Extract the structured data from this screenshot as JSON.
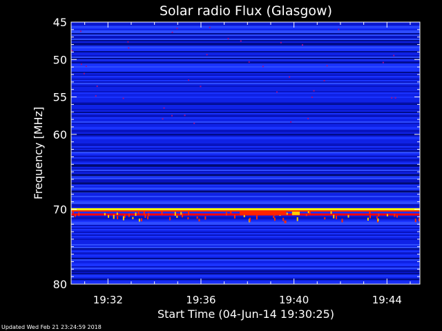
{
  "chart_data": {
    "type": "heatmap",
    "title": "Solar radio Flux (Glasgow)",
    "xlabel": "Start Time (04-Jun-14 19:30:25)",
    "ylabel": "Frequency [MHz]",
    "xlim": [
      "19:30:25",
      "19:45:25"
    ],
    "ylim": [
      45,
      80
    ],
    "y_reversed": true,
    "xticks": [
      "19:32",
      "19:36",
      "19:40",
      "19:44"
    ],
    "yticks": [
      45,
      50,
      55,
      60,
      70,
      80
    ],
    "colormap": [
      "#0000ff",
      "#ff0000",
      "#ffff00"
    ],
    "features": [
      {
        "kind": "continuous_band",
        "freq_mhz": 70.0,
        "color": "#ffff00"
      },
      {
        "kind": "continuous_band",
        "freq_mhz": 70.7,
        "color": "#ff0000"
      },
      {
        "kind": "burst",
        "time_start": "19:37:40",
        "time_end": "19:39:40",
        "freq_mhz": 70.5,
        "color": "#ff2200"
      },
      {
        "kind": "burst",
        "time_start": "19:39:55",
        "time_end": "19:40:15",
        "freq_mhz": 70.5,
        "color": "#ffcc00"
      }
    ]
  },
  "footer": {
    "updated": "Updated Wed Feb 21 23:24:59 2018"
  },
  "colors": {
    "background": "#000000",
    "text": "#ffffff",
    "axis": "#ffffff"
  }
}
